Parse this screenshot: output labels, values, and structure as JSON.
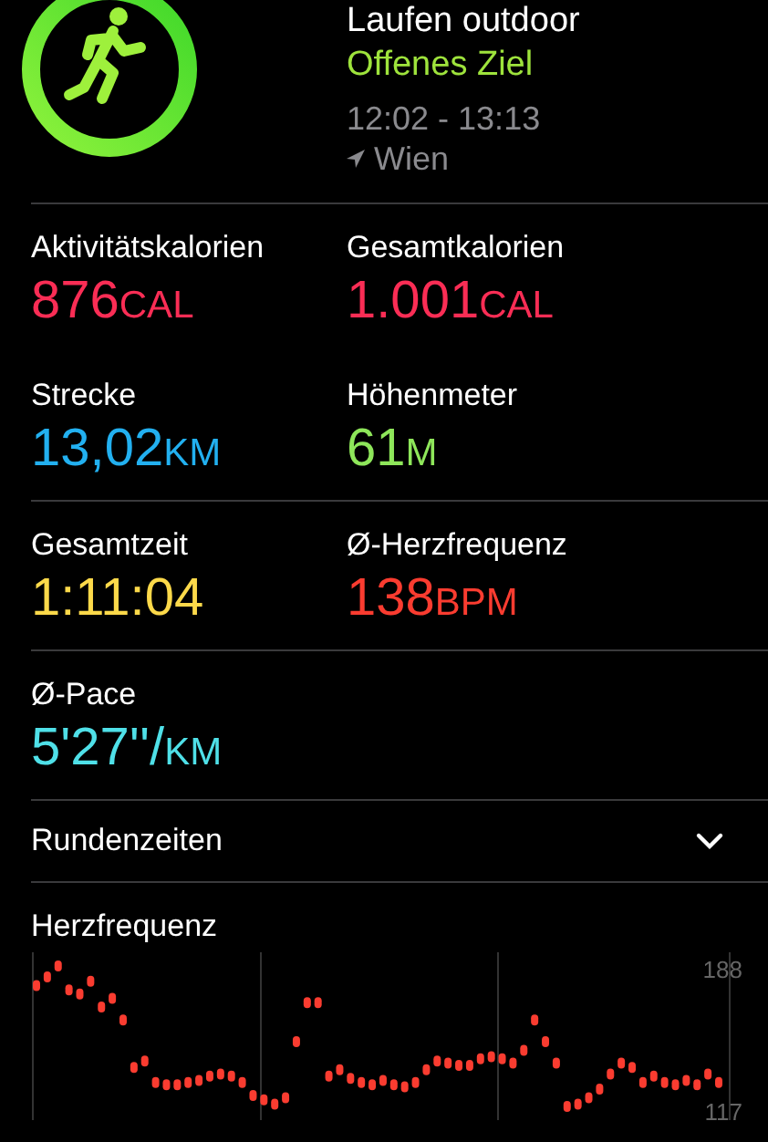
{
  "workout": {
    "title": "Laufen outdoor",
    "goal": "Offenes Ziel",
    "time": "12:02 - 13:13",
    "location": "Wien"
  },
  "metric_rows": [
    {
      "metrics": [
        {
          "label": "Aktivitätskalorien",
          "value": "876",
          "unit": "CAL",
          "color": "#fa2d55"
        },
        {
          "label": "Gesamtkalorien",
          "value": "1.001",
          "unit": "CAL",
          "color": "#fa2d55"
        }
      ],
      "divider": true
    },
    {
      "metrics": [
        {
          "label": "Strecke",
          "value": "13,02",
          "unit": "KM",
          "color": "#22b0f0"
        },
        {
          "label": "Höhenmeter",
          "value": "61",
          "unit": "M",
          "color": "#8ee65a"
        }
      ],
      "divider": false
    },
    {
      "metrics": [
        {
          "label": "Gesamtzeit",
          "value": "1:11:04",
          "color": "#fcd94a"
        },
        {
          "label": "Ø-Herzfrequenz",
          "value": "138",
          "unit": "BPM",
          "color": "#fa3c30"
        }
      ],
      "divider": true
    },
    {
      "metrics": [
        {
          "label": "Ø-Pace",
          "value": "5'27''/",
          "unit": "KM",
          "color": "#4fe0e8"
        }
      ],
      "divider": true
    }
  ],
  "laps": {
    "label": "Rundenzeiten",
    "expanded": false
  },
  "heart_rate": {
    "title": "Herzfrequenz",
    "scale_max": "188",
    "scale_min": "117"
  }
}
